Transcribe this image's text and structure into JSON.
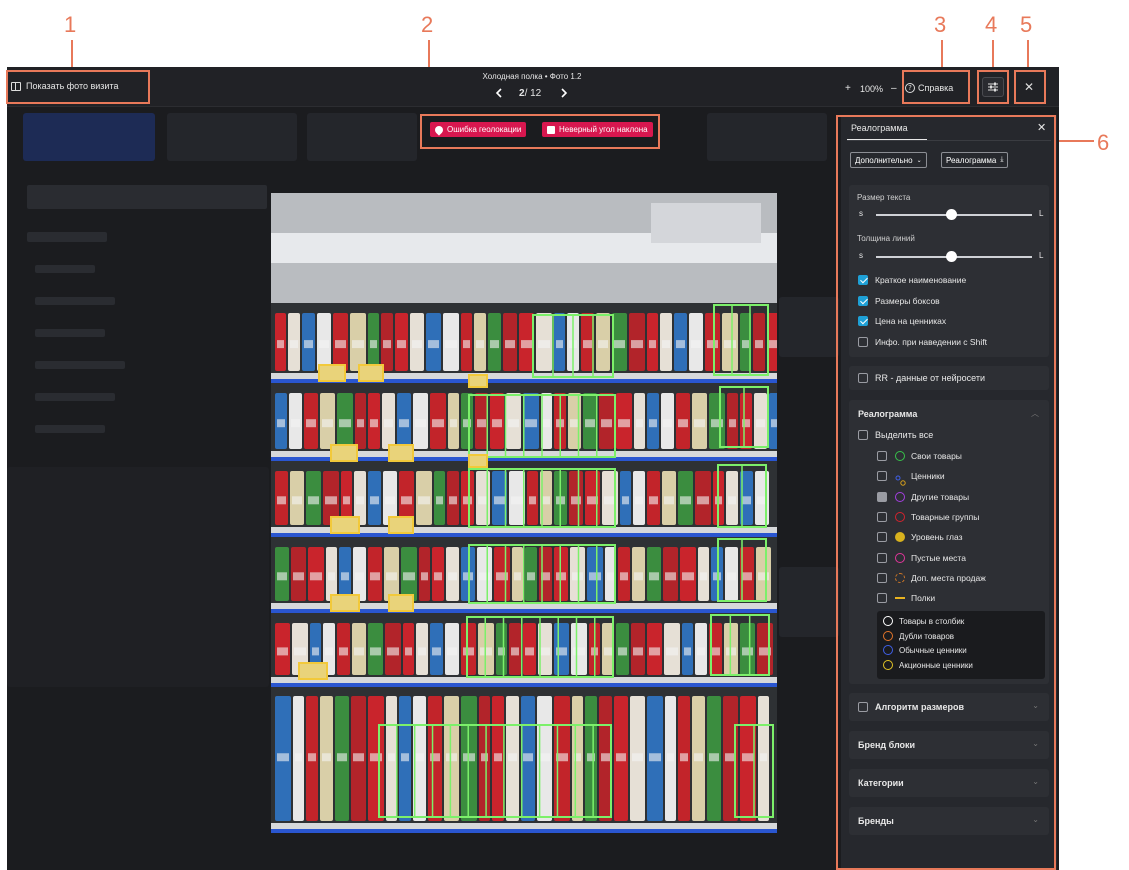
{
  "callouts": [
    "1",
    "2",
    "3",
    "4",
    "5",
    "6"
  ],
  "topbar": {
    "show_photos_label": "Показать фото визита",
    "title": "Холодная полка • Фото 1.2",
    "page_current": "2",
    "page_total": "/ 12",
    "zoom_plus": "+",
    "zoom_value": "100%",
    "zoom_minus": "–",
    "help_label": "Справка",
    "close_symbol": "✕"
  },
  "alerts": [
    "Ошибка геолокации",
    "Неверный угол наклона"
  ],
  "panel": {
    "tab_title": "Реалограмма",
    "dropdown_label": "Дополнительно",
    "realogram_button": "Реалограмма",
    "text_size_label": "Размер текста",
    "line_width_label": "Толщина линий",
    "slider_min": "s",
    "slider_max": "L",
    "text_size_value": 0.48,
    "line_width_value": 0.48,
    "options": [
      {
        "label": "Краткое наименование",
        "checked": true
      },
      {
        "label": "Размеры боксов",
        "checked": true
      },
      {
        "label": "Цена на ценниках",
        "checked": true
      },
      {
        "label": "Инфо. при наведении с Shift",
        "checked": false
      }
    ],
    "rr_label": "RR - данные от нейросети",
    "realogram_section": {
      "title": "Реалограмма",
      "select_all": "Выделить все",
      "items": [
        {
          "label": "Свои товары",
          "color": "#37c24a",
          "icon": "ring"
        },
        {
          "label": "Ценники",
          "color": "#d9a11a",
          "icon": "price-tag"
        },
        {
          "label": "Другие товары",
          "color": "#a43ee0",
          "icon": "ring"
        },
        {
          "label": "Товарные группы",
          "color": "#d4232e",
          "icon": "ring"
        },
        {
          "label": "Уровень глаз",
          "color": "#d8b21e",
          "icon": "dot"
        },
        {
          "label": "Пустые места",
          "color": "#e0369a",
          "icon": "ring"
        },
        {
          "label": "Доп. места продаж",
          "color": "#d57a25",
          "icon": "dashed-ring"
        },
        {
          "label": "Полки",
          "color": "#e9b320",
          "icon": "line"
        }
      ],
      "legend": [
        {
          "label": "Товары в столбик",
          "color": "#ffffff"
        },
        {
          "label": "Дубли товаров",
          "color": "#e0742a"
        },
        {
          "label": "Обычные ценники",
          "color": "#3f5fe6"
        },
        {
          "label": "Акционные ценники",
          "color": "#e1c326"
        }
      ]
    },
    "collapsibles": [
      "Алгоритм размеров",
      "Бренд блоки",
      "Категории",
      "Бренды"
    ]
  }
}
